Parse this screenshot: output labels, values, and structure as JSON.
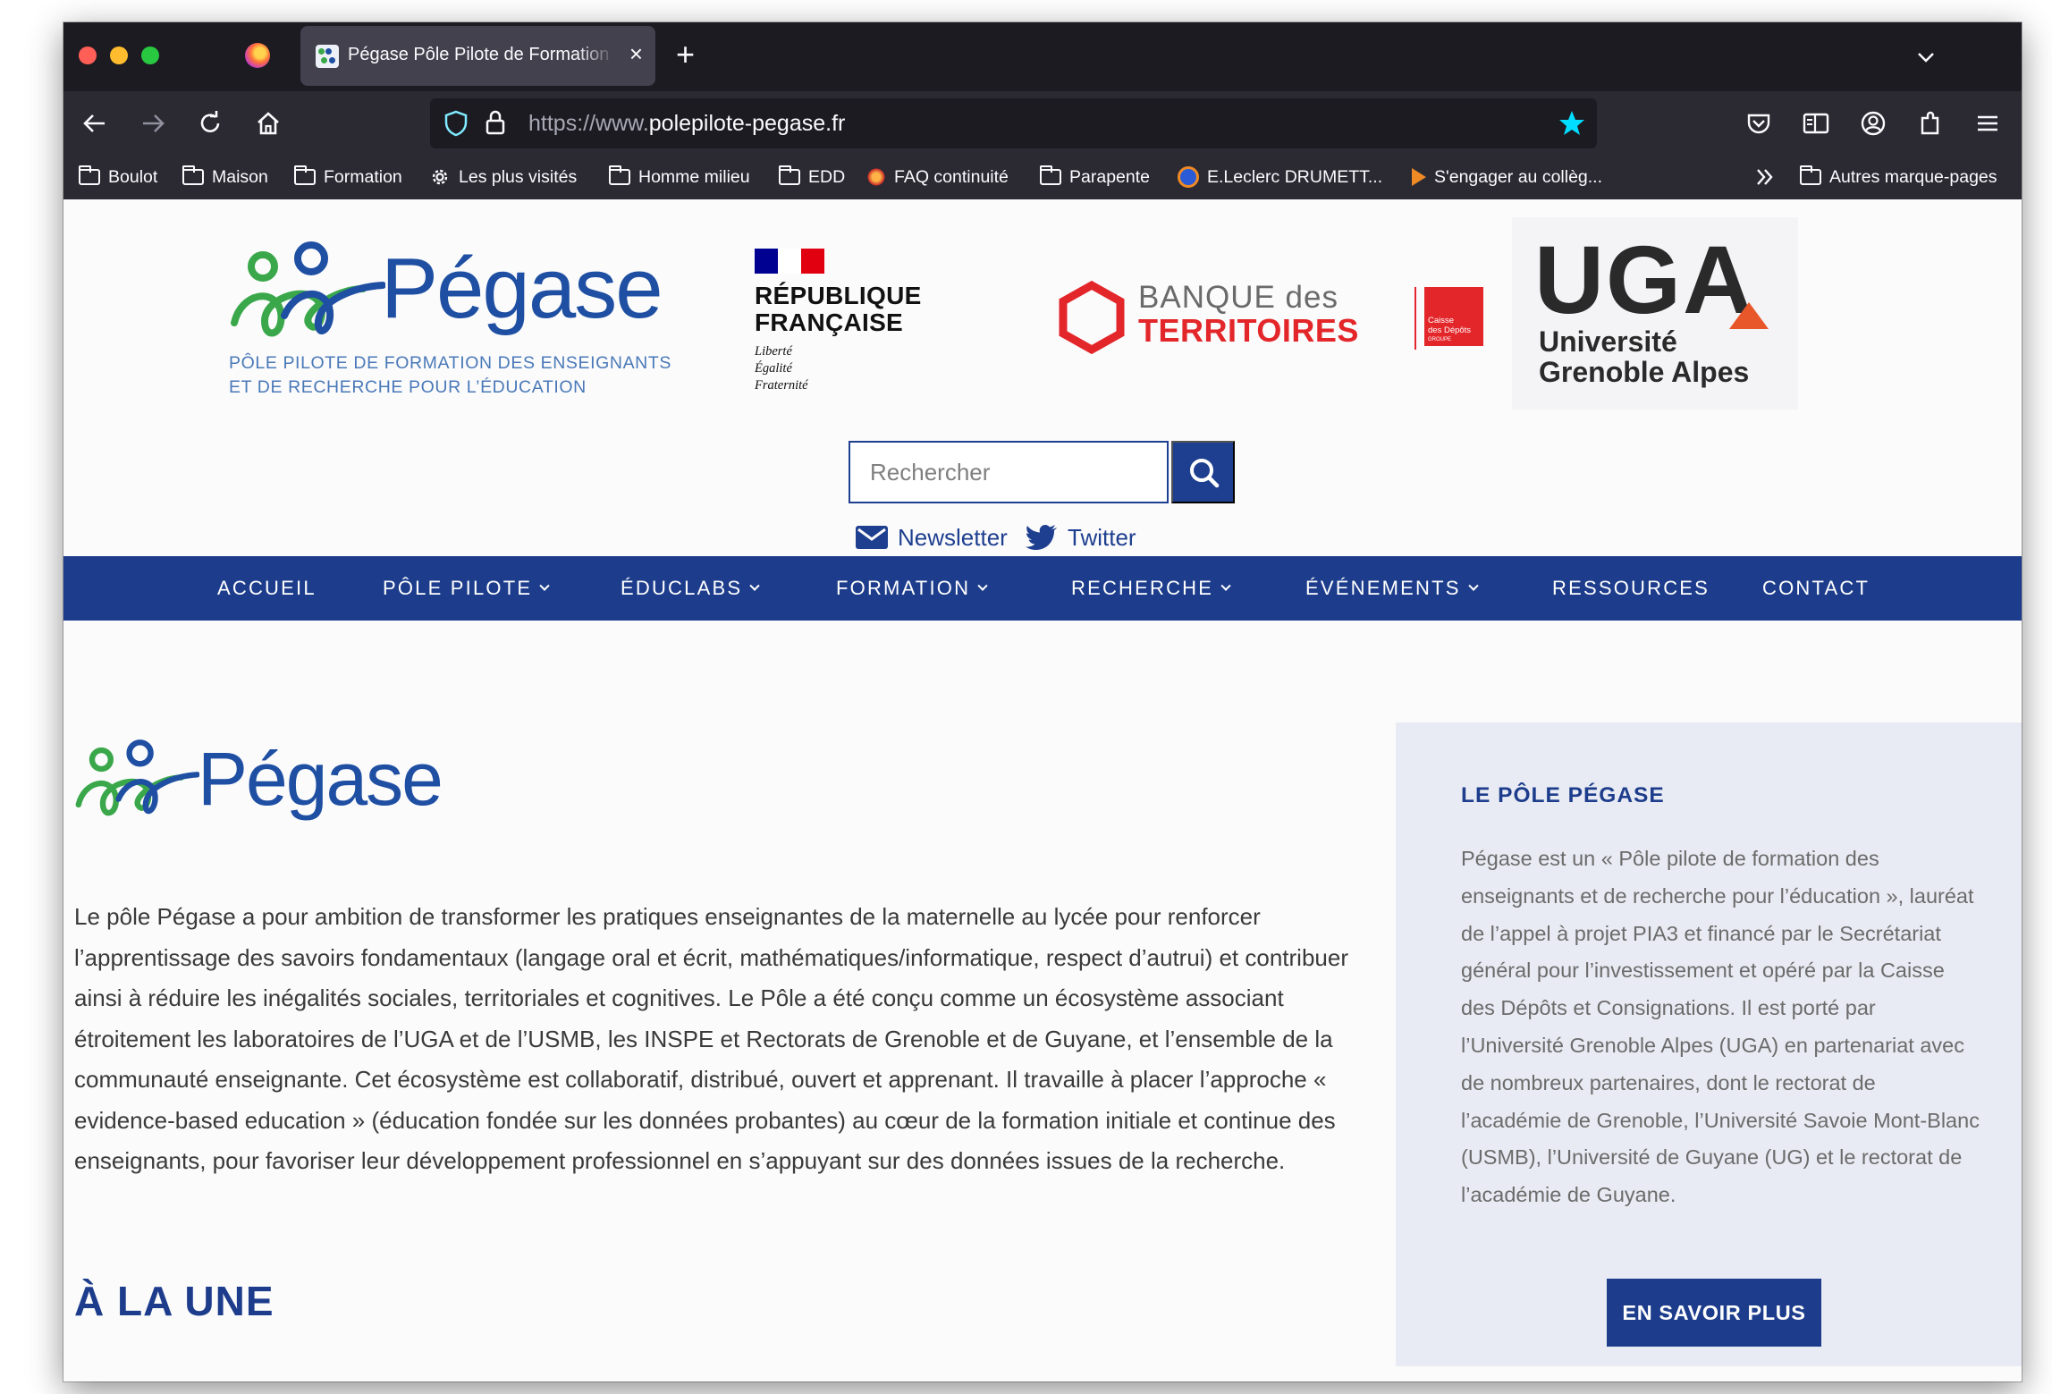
{
  "browser": {
    "tab_title": "Pégase Pôle Pilote de Formation",
    "tab_close_glyph": "×",
    "new_tab_glyph": "+",
    "url_prefix": "https://www.",
    "url_domain": "polepilote-pegase.fr",
    "bookmarks": [
      {
        "label": "Boulot",
        "icon": "folder-icon"
      },
      {
        "label": "Maison",
        "icon": "folder-icon"
      },
      {
        "label": "Formation",
        "icon": "folder-icon"
      },
      {
        "label": "Les plus visités",
        "icon": "gear-icon"
      },
      {
        "label": "Homme milieu",
        "icon": "folder-icon"
      },
      {
        "label": "EDD",
        "icon": "folder-icon"
      },
      {
        "label": "FAQ continuité",
        "icon": "site-favicon"
      },
      {
        "label": "Parapente",
        "icon": "folder-icon"
      },
      {
        "label": "E.Leclerc DRUMETT...",
        "icon": "site-favicon"
      },
      {
        "label": "S'engager au collèg...",
        "icon": "site-favicon"
      }
    ],
    "other_bookmarks": "Autres marque-pages",
    "colors": {
      "chrome_dark": "#1c1b22",
      "chrome_toolbar": "#2b2a33",
      "star_accent": "#0df"
    }
  },
  "header": {
    "pegase_logo_text": "Pégase",
    "pegase_tagline_1": "PÔLE PILOTE DE FORMATION DES ENSEIGNANTS",
    "pegase_tagline_2": "ET DE RECHERCHE POUR L’ÉDUCATION",
    "rf_title_1": "RÉPUBLIQUE",
    "rf_title_2": "FRANÇAISE",
    "rf_motto_1": "Liberté",
    "rf_motto_2": "Égalité",
    "rf_motto_3": "Fraternité",
    "bdt_line1": "BANQUE des",
    "bdt_line2": "TERRITOIRES",
    "cdc_1": "Caisse",
    "cdc_2": "des Dépôts",
    "cdc_3": "GROUPE",
    "uga_big": "UGA",
    "uga_line1": "Université",
    "uga_line2": "Grenoble Alpes",
    "search_placeholder": "Rechercher",
    "newsletter": "Newsletter",
    "twitter": "Twitter",
    "colors": {
      "brand_blue": "#1d3d8c",
      "brand_red": "#e3262a",
      "uga_orange": "#e8572a"
    }
  },
  "nav": [
    {
      "label": "ACCUEIL",
      "dropdown": false
    },
    {
      "label": "PÔLE PILOTE",
      "dropdown": true
    },
    {
      "label": "ÉDUCLABS",
      "dropdown": true
    },
    {
      "label": "FORMATION",
      "dropdown": true
    },
    {
      "label": "RECHERCHE",
      "dropdown": true
    },
    {
      "label": "ÉVÉNEMENTS",
      "dropdown": true
    },
    {
      "label": "RESSOURCES",
      "dropdown": false
    },
    {
      "label": "CONTACT",
      "dropdown": false
    }
  ],
  "main": {
    "logo_text": "Pégase",
    "intro": "Le pôle Pégase a pour ambition de transformer les pratiques enseignantes de la maternelle au lycée pour renforcer l’apprentissage des savoirs fondamentaux (langage oral et écrit, mathématiques/informatique, respect d’autrui) et contribuer ainsi à réduire les inégalités sociales, territoriales et cognitives. Le Pôle a été conçu comme un écosystème associant étroitement les laboratoires de l’UGA et de l’USMB, les INSPE et Rectorats de Grenoble et de Guyane, et l’ensemble de la communauté enseignante. Cet écosystème est collaboratif, distribué, ouvert et apprenant. Il travaille à placer l’approche « evidence-based education » (éducation fondée sur les données probantes) au cœur de la formation initiale et continue des enseignants, pour favoriser leur développement professionnel en s’appuyant sur des données issues de la recherche.",
    "section_title": "À LA UNE"
  },
  "aside": {
    "title": "LE PÔLE PÉGASE",
    "text": "Pégase est un « Pôle pilote de formation des enseignants et de recherche pour l’éducation », lauréat de l’appel à projet PIA3 et financé par le Secrétariat général pour l’investissement et opéré par la Caisse des Dépôts et Consignations. Il est porté par l’Université Grenoble Alpes (UGA) en partenariat avec de nombreux partenaires, dont le rectorat de l’académie de Grenoble, l’Université Savoie Mont-Blanc (USMB), l’Université de Guyane (UG) et le rectorat de l’académie de Guyane.",
    "button": "EN SAVOIR PLUS"
  }
}
